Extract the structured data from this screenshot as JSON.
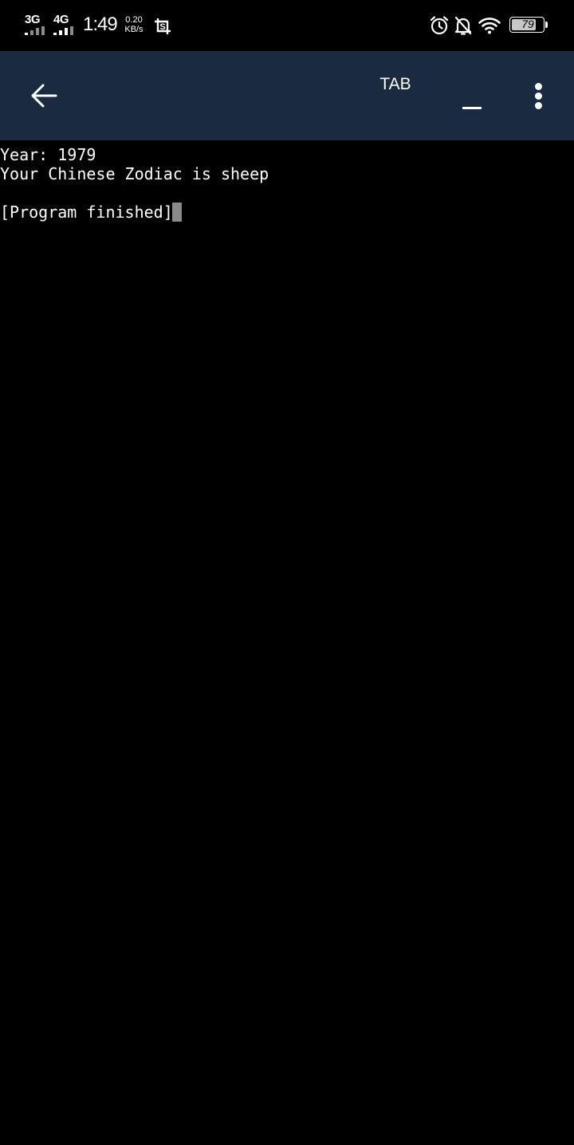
{
  "status_bar": {
    "network_1": "3G",
    "network_2": "4G",
    "time": "1:49",
    "speed_value": "0.20",
    "speed_unit": "KB/s",
    "battery_level": "79",
    "battery_fraction": 0.79,
    "icons": [
      "screenshot-icon",
      "alarm-icon",
      "bell-off-icon",
      "wifi-icon",
      "battery-icon"
    ]
  },
  "app_bar": {
    "background": "#1a2a40",
    "back_icon": "arrow-left-icon",
    "tab_label": "TAB",
    "underscore_label": "_",
    "more_icon": "more-vertical-icon"
  },
  "terminal": {
    "lines": [
      "Year: 1979",
      "Your Chinese Zodiac is sheep",
      "",
      "[Program finished]"
    ]
  }
}
